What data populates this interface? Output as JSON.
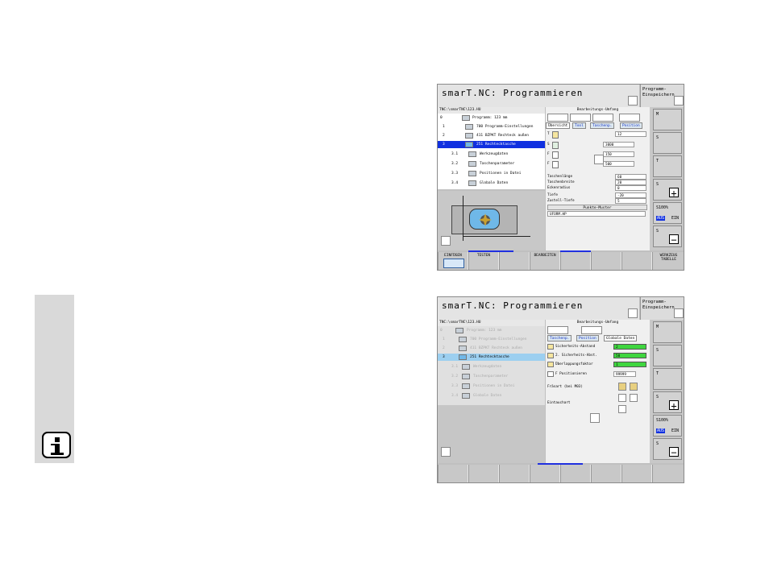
{
  "screen1": {
    "title": "smarT.NC: Programmieren",
    "prog_label": "Programm-Einspeichern",
    "path": "TNC:\\smarTNC\\123.HU",
    "tree": [
      {
        "n": "0",
        "text": "Programm: 123 mm"
      },
      {
        "n": "1",
        "text": "700 Programm-Einstellungen"
      },
      {
        "n": "2",
        "text": "411 BZPKT Rechteck außen"
      },
      {
        "n": "3",
        "text": "251 Rechtecktasche"
      },
      {
        "n": "3.1",
        "text": "Werkzeugdaten"
      },
      {
        "n": "3.2",
        "text": "Taschenparameter"
      },
      {
        "n": "3.3",
        "text": "Positionen in Datei"
      },
      {
        "n": "3.4",
        "text": "Globale Daten"
      }
    ],
    "form_header": "Bearbeitungs-Umfang",
    "tabs": [
      "Übersicht",
      "Tool",
      "Taschenp.",
      "Position"
    ],
    "fields": [
      {
        "label": "T",
        "value": "12"
      },
      {
        "label": "S",
        "value": "3000"
      },
      {
        "label": "F",
        "value": "150"
      },
      {
        "label": "F",
        "value": "500"
      },
      {
        "label": "Taschenlänge",
        "value": "60"
      },
      {
        "label": "Taschenbreite",
        "value": "20"
      },
      {
        "label": "Eckenradius",
        "value": "0"
      },
      {
        "label": "Tiefe",
        "value": "-20"
      },
      {
        "label": "Zustell-Tiefe",
        "value": "5"
      }
    ],
    "section": "Punkte-Muster",
    "pattern_file": "UFORM.HP",
    "side_buttons": [
      "M",
      "S",
      "T",
      "S",
      "S100%",
      "S"
    ],
    "spindle_aus": "AUS",
    "spindle_ein": "EIN",
    "softkeys": [
      "EINFÜGEN",
      "TESTEN",
      "",
      "",
      "BEARBEITEN",
      "",
      "",
      "WERKZEUG TABELLE"
    ]
  },
  "screen2": {
    "title": "smarT.NC: Programmieren",
    "prog_label": "Programm-Einspeichern",
    "path": "TNC:\\smarTNC\\123.HU",
    "tree": [
      {
        "n": "0",
        "text": "Programm: 123 mm"
      },
      {
        "n": "1",
        "text": "700 Programm-Einstellungen"
      },
      {
        "n": "2",
        "text": "411 BZPKT Rechteck außen"
      },
      {
        "n": "3",
        "text": "251 Rechtecktasche"
      },
      {
        "n": "3.1",
        "text": "Werkzeugdaten"
      },
      {
        "n": "3.2",
        "text": "Taschenparameter"
      },
      {
        "n": "3.3",
        "text": "Positionen in Datei"
      },
      {
        "n": "3.4",
        "text": "Globale Daten"
      }
    ],
    "form_header": "Bearbeitungs-Umfang",
    "tabs": [
      "Taschenp.",
      "Position",
      "Globale Daten"
    ],
    "fields": [
      {
        "label": "Sicherheits-Abstand",
        "value": "2"
      },
      {
        "label": "2. Sicherheits-Abst.",
        "value": "50"
      },
      {
        "label": "Überlappungsfaktor",
        "value": "1"
      },
      {
        "label": "F Positionieren",
        "value": "99999"
      }
    ],
    "fraesart_label": "Fräsart (bei M03)",
    "eintauchart_label": "Eintauchart",
    "side_buttons": [
      "M",
      "S",
      "T",
      "S",
      "S100%",
      "S"
    ],
    "spindle_aus": "AUS",
    "spindle_ein": "EIN"
  },
  "accent": "#1030e0"
}
